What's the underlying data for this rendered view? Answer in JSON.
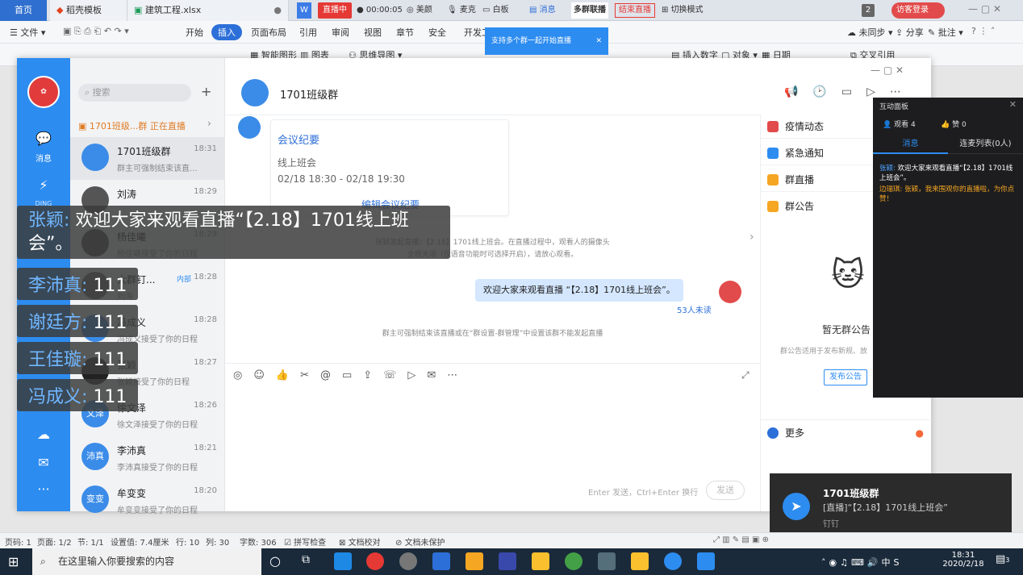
{
  "tabs": {
    "home": "首页",
    "t1": "稻壳模板",
    "t2": "建筑工程.xlsx"
  },
  "live": {
    "status": "直播中",
    "timer": "00:00:05",
    "beauty": "美颜",
    "mic": "麦克",
    "whiteboard": "白板",
    "message": "消息",
    "multi_group": "多群联播",
    "end_live": "结束直播",
    "switch_mode": "切换模式",
    "hint": "支持多个群一起开始直播"
  },
  "wps": {
    "guest_login": "访客登录",
    "badge": "2",
    "file": "文件",
    "menus": [
      "开始",
      "插入",
      "页面布局",
      "引用",
      "审阅",
      "视图",
      "章节",
      "安全",
      "开发工具"
    ],
    "sync": "未同步",
    "share": "分享",
    "annotate": "批注"
  },
  "ribbon": {
    "smart_shape": "智能图形",
    "chart": "图表",
    "mindmap": "思维导图",
    "insert_number": "插入数字",
    "object": "对象",
    "date": "日期",
    "cross_ref": "交叉引用"
  },
  "sidebar": {
    "search_placeholder": "搜索",
    "live_banner": "1701班级...群 正在直播",
    "conversations": [
      {
        "name": "1701班级群",
        "time": "18:31",
        "msg": "群主可强制结束该直...",
        "avatar": ""
      },
      {
        "name": "刘涛",
        "time": "18:29",
        "msg": "",
        "avatar": ""
      },
      {
        "name": "杨佳曦",
        "time": "18:29",
        "msg": "杨佳曦接受了你的日程",
        "avatar": ""
      },
      {
        "name": "大群钉...",
        "time": "18:28",
        "msg": "刘海",
        "avatar": "",
        "tag": "内部"
      },
      {
        "name": "冯成义",
        "time": "18:28",
        "msg": "冯成义接受了你的日程",
        "avatar": ""
      },
      {
        "name": "张颖",
        "time": "18:27",
        "msg": "张颖接受了你的日程",
        "avatar": ""
      },
      {
        "name": "徐文泽",
        "time": "18:26",
        "msg": "徐文泽接受了你的日程",
        "avatar": "文泽"
      },
      {
        "name": "李沛真",
        "time": "18:21",
        "msg": "李沛真接受了你的日程",
        "avatar": "沛真"
      },
      {
        "name": "牟变变",
        "time": "18:20",
        "msg": "牟变变接受了你的日程",
        "avatar": "变变"
      }
    ],
    "rail_label_msg": "消息",
    "rail_label_ding": "DING"
  },
  "chat": {
    "title": "1701班级群",
    "card_title": "会议纪要",
    "card_sub": "线上班会",
    "card_time": "02/18 18:30 - 02/18 19:30",
    "card_link": "编辑会议纪要",
    "system1": "张颖发起直播：【2.18】1701线上班会。在直播过程中，观看人的摄像头",
    "system2": "全程关闭（仅语音功能时可选择开启），请放心观看。",
    "my_msg": "欢迎大家来观看直播 “【2.18】1701线上班会”。",
    "unread": "53人未读",
    "system3": "群主可强制结束该直播或在“群设置-群管理”中设置该群不能发起直播",
    "input_placeholder": "Enter 发送，Ctrl+Enter 换行",
    "send": "发送"
  },
  "right_panel": {
    "items": [
      "疫情动态",
      "紧急通知",
      "群直播",
      "群公告"
    ],
    "empty_title": "暂无群公告",
    "empty_desc": "群公告适用于发布新规、放",
    "publish": "发布公告",
    "more": "更多"
  },
  "comments": [
    {
      "name": "张颖",
      "text": "欢迎大家来观看直播“【2.18】1701线上班会”。"
    },
    {
      "name": "李沛真",
      "text": "111"
    },
    {
      "name": "谢廷方",
      "text": "111"
    },
    {
      "name": "王佳璇",
      "text": "111"
    },
    {
      "name": "冯成义",
      "text": "111"
    }
  ],
  "interactive": {
    "title": "互动面板",
    "viewers": "观看 4",
    "likes": "赞 0",
    "tab_msg": "消息",
    "tab_mic": "连麦列表(0人)",
    "m1_name": "张颖:",
    "m1_text": "欢迎大家来观看直播“【2.18】1701线上班会”。",
    "m2_name": "边瑞琪:",
    "m2_text": "张颖，我来围观你的直播啦，为你点赞！"
  },
  "notification": {
    "title": "1701班级群",
    "body": "[直播]“【2.18】1701线上班会”",
    "app": "钉钉"
  },
  "status": {
    "page": "页码: 1",
    "pages": "页面: 1/2",
    "section": "节: 1/1",
    "setting": "设置值: 7.4厘米",
    "row": "行: 10",
    "col": "列: 30",
    "words": "字数: 306",
    "spell": "拼写检查",
    "proof": "文档校对",
    "protect": "文档未保护"
  },
  "taskbar": {
    "search": "在这里输入你要搜索的内容",
    "time": "18:31",
    "date": "2020/2/18",
    "lang": "中",
    "notif_count": "3"
  }
}
